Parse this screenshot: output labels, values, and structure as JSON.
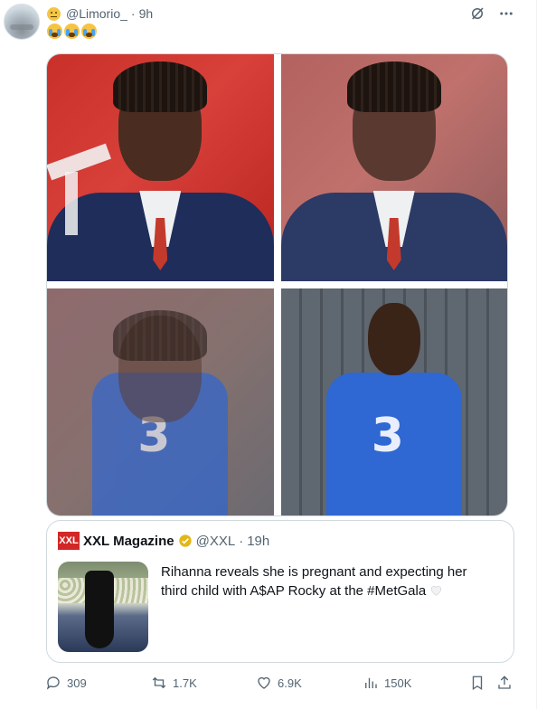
{
  "tweet": {
    "handle": "@Limorio_",
    "separator": "·",
    "time": "9h",
    "emoji_text": "😭😭😭"
  },
  "media": {
    "images": [
      {
        "label": "portrait-red-backdrop"
      },
      {
        "label": "portrait-blend-1"
      },
      {
        "label": "portrait-blend-2"
      },
      {
        "label": "portrait-jersey"
      }
    ]
  },
  "quote": {
    "logo": "XXL",
    "name": "XXL Magazine",
    "handle": "@XXL",
    "separator": "·",
    "time": "19h",
    "text": "Rihanna reveals she is pregnant and expecting her third child with A$AP Rocky at the #MetGala"
  },
  "actions": {
    "replies": "309",
    "reposts": "1.7K",
    "likes": "6.9K",
    "views": "150K"
  },
  "colors": {
    "secondary_text": "#536471",
    "border": "#cfd9de",
    "verified_gold": "#e2b719"
  }
}
